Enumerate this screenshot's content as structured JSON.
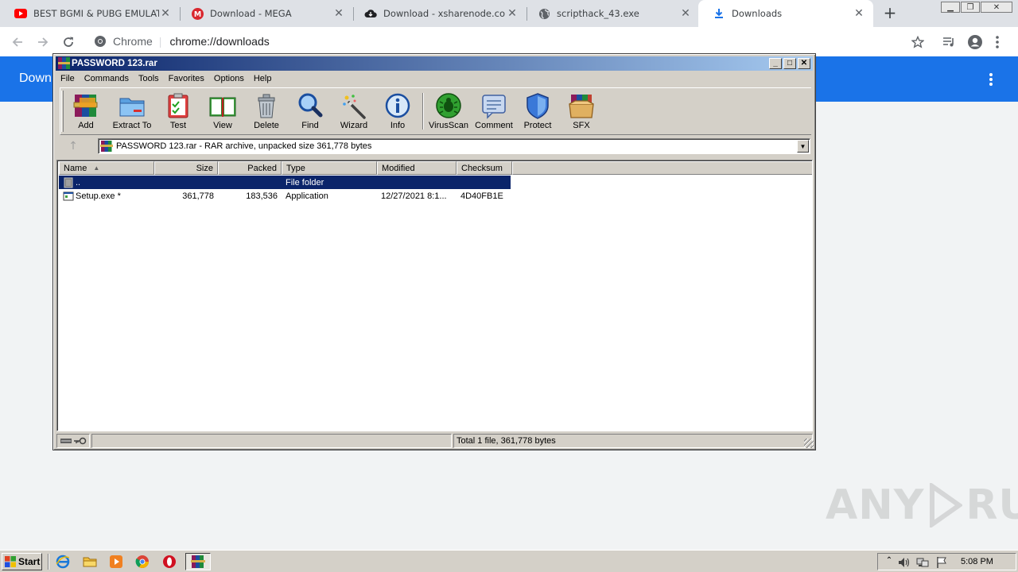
{
  "browser": {
    "tabs": [
      {
        "title": "BEST BGMI & PUBG EMULATOR F",
        "favicon": "youtube-icon"
      },
      {
        "title": "Download - MEGA",
        "favicon": "mega-icon"
      },
      {
        "title": "Download - xsharenode.com",
        "favicon": "cloud-icon"
      },
      {
        "title": "scripthack_43.exe",
        "favicon": "globe-icon"
      },
      {
        "title": "Downloads",
        "favicon": "download-icon",
        "active": true
      }
    ],
    "new_tab": "+",
    "omnibox": {
      "site_label": "Chrome",
      "url": "chrome://downloads"
    }
  },
  "downloads_page": {
    "title": "Down"
  },
  "winrar": {
    "title": "PASSWORD 123.rar",
    "menu": [
      "File",
      "Commands",
      "Tools",
      "Favorites",
      "Options",
      "Help"
    ],
    "toolbar": [
      {
        "label": "Add",
        "icon": "add-archive-icon"
      },
      {
        "label": "Extract To",
        "icon": "extract-folder-icon"
      },
      {
        "label": "Test",
        "icon": "test-clipboard-icon"
      },
      {
        "label": "View",
        "icon": "view-book-icon"
      },
      {
        "label": "Delete",
        "icon": "trash-icon"
      },
      {
        "label": "Find",
        "icon": "magnifier-icon"
      },
      {
        "label": "Wizard",
        "icon": "magic-wand-icon"
      },
      {
        "label": "Info",
        "icon": "info-icon"
      },
      {
        "label": "VirusScan",
        "icon": "virus-scan-icon"
      },
      {
        "label": "Comment",
        "icon": "comment-icon"
      },
      {
        "label": "Protect",
        "icon": "shield-icon"
      },
      {
        "label": "SFX",
        "icon": "sfx-box-icon"
      }
    ],
    "address": "PASSWORD 123.rar - RAR archive, unpacked size 361,778 bytes",
    "columns": [
      "Name",
      "Size",
      "Packed",
      "Type",
      "Modified",
      "Checksum"
    ],
    "rows": [
      {
        "name": "..",
        "size": "",
        "packed": "",
        "type": "File folder",
        "modified": "",
        "checksum": "",
        "selected": true
      },
      {
        "name": "Setup.exe *",
        "size": "361,778",
        "packed": "183,536",
        "type": "Application",
        "modified": "12/27/2021 8:1...",
        "checksum": "4D40FB1E",
        "selected": false
      }
    ],
    "status": "Total 1 file, 361,778 bytes"
  },
  "taskbar": {
    "start_label": "Start",
    "clock": "5:08 PM"
  },
  "watermark": {
    "left": "ANY",
    "right": "RUN"
  }
}
